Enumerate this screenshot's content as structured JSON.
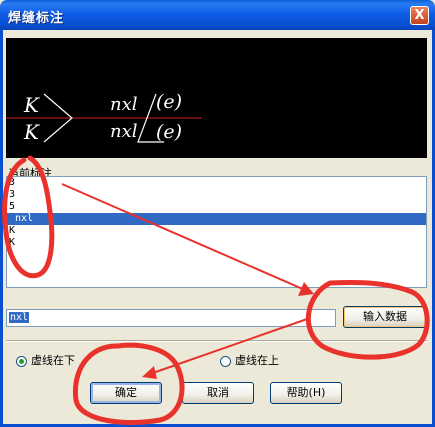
{
  "window": {
    "title": "焊缝标注",
    "close_glyph": "X"
  },
  "preview": {
    "left_top": "K",
    "left_bottom": "K",
    "right_top": "nxl",
    "right_bottom": "nxl",
    "paren_top": "(e)",
    "paren_bottom": "(e)"
  },
  "current": {
    "label": "当前标注",
    "items": [
      "3",
      "3",
      "5",
      "nxl",
      "K",
      "K"
    ],
    "selected_index": 3
  },
  "input": {
    "value": "nxl",
    "button_label": "输入数据"
  },
  "radios": [
    {
      "label": "虚线在下",
      "checked": true
    },
    {
      "label": "虚线在上",
      "checked": false
    }
  ],
  "buttons": {
    "ok": "确定",
    "cancel": "取消",
    "help": "帮助(H)"
  },
  "colors": {
    "title_bar": "#0a4fd0",
    "selection": "#316ac5",
    "annotation": "#e8322b",
    "preview_bg": "#000000"
  }
}
